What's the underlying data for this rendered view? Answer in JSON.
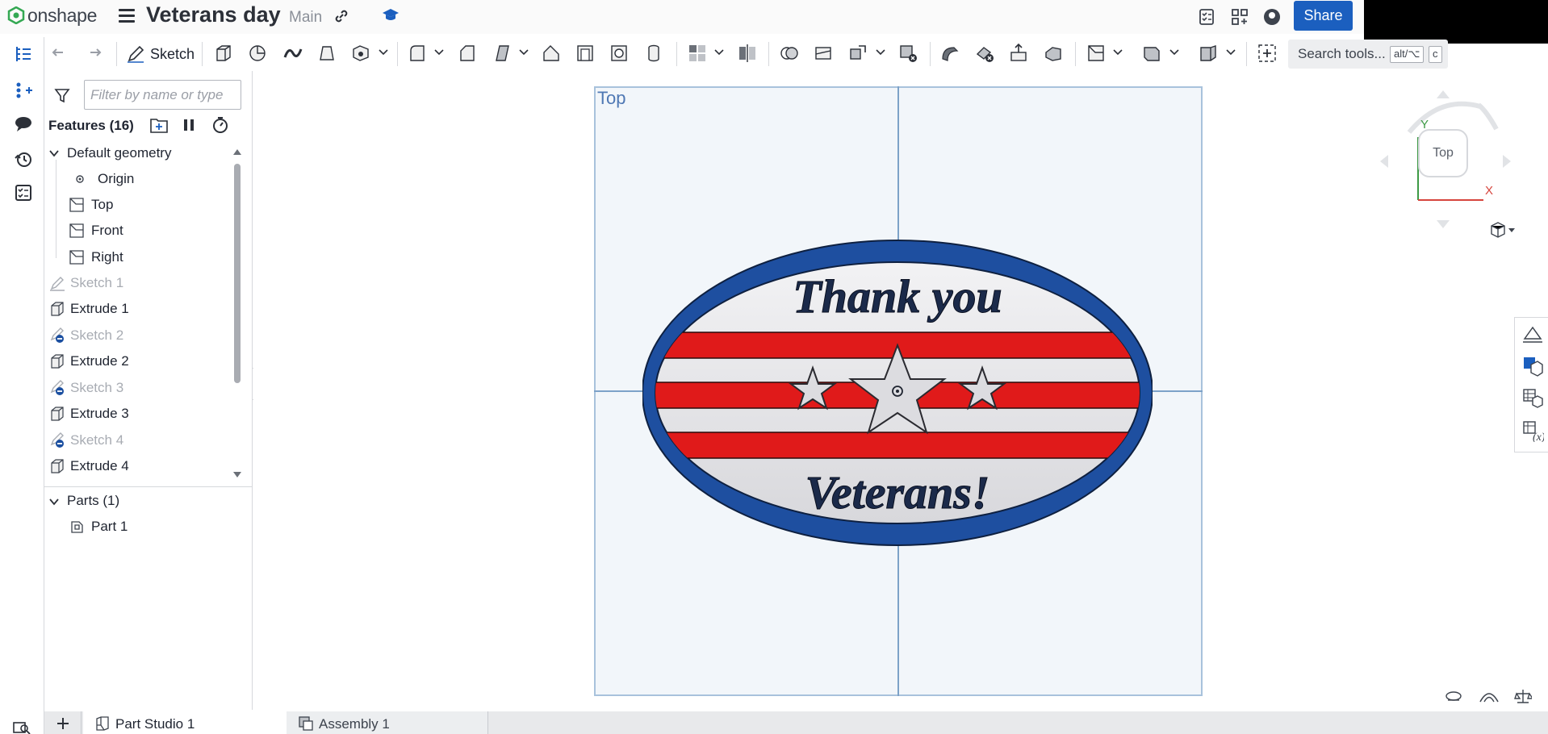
{
  "app": {
    "logo_text": "onshape",
    "document_title": "Veterans day",
    "branch": "Main",
    "share_label": "Share",
    "icons": [
      "onshape-logo-icon",
      "menu-icon",
      "link-icon",
      "learning-center-icon",
      "release-icon",
      "apps-icon",
      "help-icon"
    ]
  },
  "toolbar": {
    "sketch_label": "Sketch",
    "search_label": "Search tools...",
    "shortcut_1": "alt/⌥",
    "shortcut_2": "c"
  },
  "feature_panel": {
    "filter_placeholder": "Filter by name or type",
    "features_title": "Features (16)",
    "default_geometry": "Default geometry",
    "items": [
      {
        "label": "Origin",
        "dim": false,
        "icon": "origin-icon"
      },
      {
        "label": "Top",
        "dim": false,
        "icon": "plane-icon"
      },
      {
        "label": "Front",
        "dim": false,
        "icon": "plane-icon"
      },
      {
        "label": "Right",
        "dim": false,
        "icon": "plane-icon"
      },
      {
        "label": "Sketch 1",
        "dim": true,
        "icon": "sketch-icon"
      },
      {
        "label": "Extrude 1",
        "dim": false,
        "icon": "extrude-icon"
      },
      {
        "label": "Sketch 2",
        "dim": true,
        "icon": "sketch-hidden-icon"
      },
      {
        "label": "Extrude 2",
        "dim": false,
        "icon": "extrude-icon"
      },
      {
        "label": "Sketch 3",
        "dim": true,
        "icon": "sketch-hidden-icon"
      },
      {
        "label": "Extrude 3",
        "dim": false,
        "icon": "extrude-icon"
      },
      {
        "label": "Sketch 4",
        "dim": true,
        "icon": "sketch-hidden-icon"
      },
      {
        "label": "Extrude 4",
        "dim": false,
        "icon": "extrude-icon"
      }
    ],
    "parts_title": "Parts (1)",
    "part_1": "Part 1"
  },
  "viewport": {
    "plane_label": "Top",
    "viewcube_label": "Top",
    "axis_x": "X",
    "axis_y": "Y",
    "model_text_top": "Thank you",
    "model_text_bottom": "Veterans!",
    "colors": {
      "blue": "#1e4fa0",
      "red": "#e01a1a",
      "white": "#e4e4e8",
      "plane": "#f2f6fa"
    }
  },
  "tabs": {
    "tab_1": "Part Studio 1",
    "tab_2": "Assembly 1"
  }
}
